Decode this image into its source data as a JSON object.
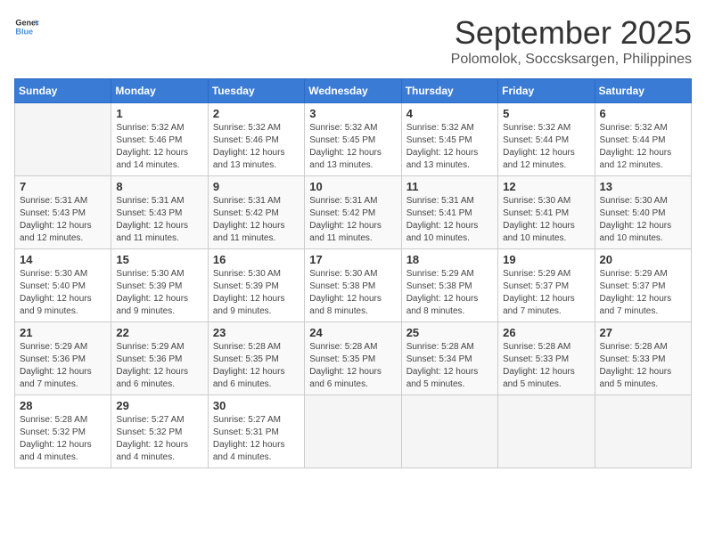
{
  "header": {
    "logo_general": "General",
    "logo_blue": "Blue",
    "month_title": "September 2025",
    "location": "Polomolok, Soccsksargen, Philippines"
  },
  "weekdays": [
    "Sunday",
    "Monday",
    "Tuesday",
    "Wednesday",
    "Thursday",
    "Friday",
    "Saturday"
  ],
  "weeks": [
    [
      {
        "day": "",
        "info": ""
      },
      {
        "day": "1",
        "info": "Sunrise: 5:32 AM\nSunset: 5:46 PM\nDaylight: 12 hours\nand 14 minutes."
      },
      {
        "day": "2",
        "info": "Sunrise: 5:32 AM\nSunset: 5:46 PM\nDaylight: 12 hours\nand 13 minutes."
      },
      {
        "day": "3",
        "info": "Sunrise: 5:32 AM\nSunset: 5:45 PM\nDaylight: 12 hours\nand 13 minutes."
      },
      {
        "day": "4",
        "info": "Sunrise: 5:32 AM\nSunset: 5:45 PM\nDaylight: 12 hours\nand 13 minutes."
      },
      {
        "day": "5",
        "info": "Sunrise: 5:32 AM\nSunset: 5:44 PM\nDaylight: 12 hours\nand 12 minutes."
      },
      {
        "day": "6",
        "info": "Sunrise: 5:32 AM\nSunset: 5:44 PM\nDaylight: 12 hours\nand 12 minutes."
      }
    ],
    [
      {
        "day": "7",
        "info": "Sunrise: 5:31 AM\nSunset: 5:43 PM\nDaylight: 12 hours\nand 12 minutes."
      },
      {
        "day": "8",
        "info": "Sunrise: 5:31 AM\nSunset: 5:43 PM\nDaylight: 12 hours\nand 11 minutes."
      },
      {
        "day": "9",
        "info": "Sunrise: 5:31 AM\nSunset: 5:42 PM\nDaylight: 12 hours\nand 11 minutes."
      },
      {
        "day": "10",
        "info": "Sunrise: 5:31 AM\nSunset: 5:42 PM\nDaylight: 12 hours\nand 11 minutes."
      },
      {
        "day": "11",
        "info": "Sunrise: 5:31 AM\nSunset: 5:41 PM\nDaylight: 12 hours\nand 10 minutes."
      },
      {
        "day": "12",
        "info": "Sunrise: 5:30 AM\nSunset: 5:41 PM\nDaylight: 12 hours\nand 10 minutes."
      },
      {
        "day": "13",
        "info": "Sunrise: 5:30 AM\nSunset: 5:40 PM\nDaylight: 12 hours\nand 10 minutes."
      }
    ],
    [
      {
        "day": "14",
        "info": "Sunrise: 5:30 AM\nSunset: 5:40 PM\nDaylight: 12 hours\nand 9 minutes."
      },
      {
        "day": "15",
        "info": "Sunrise: 5:30 AM\nSunset: 5:39 PM\nDaylight: 12 hours\nand 9 minutes."
      },
      {
        "day": "16",
        "info": "Sunrise: 5:30 AM\nSunset: 5:39 PM\nDaylight: 12 hours\nand 9 minutes."
      },
      {
        "day": "17",
        "info": "Sunrise: 5:30 AM\nSunset: 5:38 PM\nDaylight: 12 hours\nand 8 minutes."
      },
      {
        "day": "18",
        "info": "Sunrise: 5:29 AM\nSunset: 5:38 PM\nDaylight: 12 hours\nand 8 minutes."
      },
      {
        "day": "19",
        "info": "Sunrise: 5:29 AM\nSunset: 5:37 PM\nDaylight: 12 hours\nand 7 minutes."
      },
      {
        "day": "20",
        "info": "Sunrise: 5:29 AM\nSunset: 5:37 PM\nDaylight: 12 hours\nand 7 minutes."
      }
    ],
    [
      {
        "day": "21",
        "info": "Sunrise: 5:29 AM\nSunset: 5:36 PM\nDaylight: 12 hours\nand 7 minutes."
      },
      {
        "day": "22",
        "info": "Sunrise: 5:29 AM\nSunset: 5:36 PM\nDaylight: 12 hours\nand 6 minutes."
      },
      {
        "day": "23",
        "info": "Sunrise: 5:28 AM\nSunset: 5:35 PM\nDaylight: 12 hours\nand 6 minutes."
      },
      {
        "day": "24",
        "info": "Sunrise: 5:28 AM\nSunset: 5:35 PM\nDaylight: 12 hours\nand 6 minutes."
      },
      {
        "day": "25",
        "info": "Sunrise: 5:28 AM\nSunset: 5:34 PM\nDaylight: 12 hours\nand 5 minutes."
      },
      {
        "day": "26",
        "info": "Sunrise: 5:28 AM\nSunset: 5:33 PM\nDaylight: 12 hours\nand 5 minutes."
      },
      {
        "day": "27",
        "info": "Sunrise: 5:28 AM\nSunset: 5:33 PM\nDaylight: 12 hours\nand 5 minutes."
      }
    ],
    [
      {
        "day": "28",
        "info": "Sunrise: 5:28 AM\nSunset: 5:32 PM\nDaylight: 12 hours\nand 4 minutes."
      },
      {
        "day": "29",
        "info": "Sunrise: 5:27 AM\nSunset: 5:32 PM\nDaylight: 12 hours\nand 4 minutes."
      },
      {
        "day": "30",
        "info": "Sunrise: 5:27 AM\nSunset: 5:31 PM\nDaylight: 12 hours\nand 4 minutes."
      },
      {
        "day": "",
        "info": ""
      },
      {
        "day": "",
        "info": ""
      },
      {
        "day": "",
        "info": ""
      },
      {
        "day": "",
        "info": ""
      }
    ]
  ]
}
